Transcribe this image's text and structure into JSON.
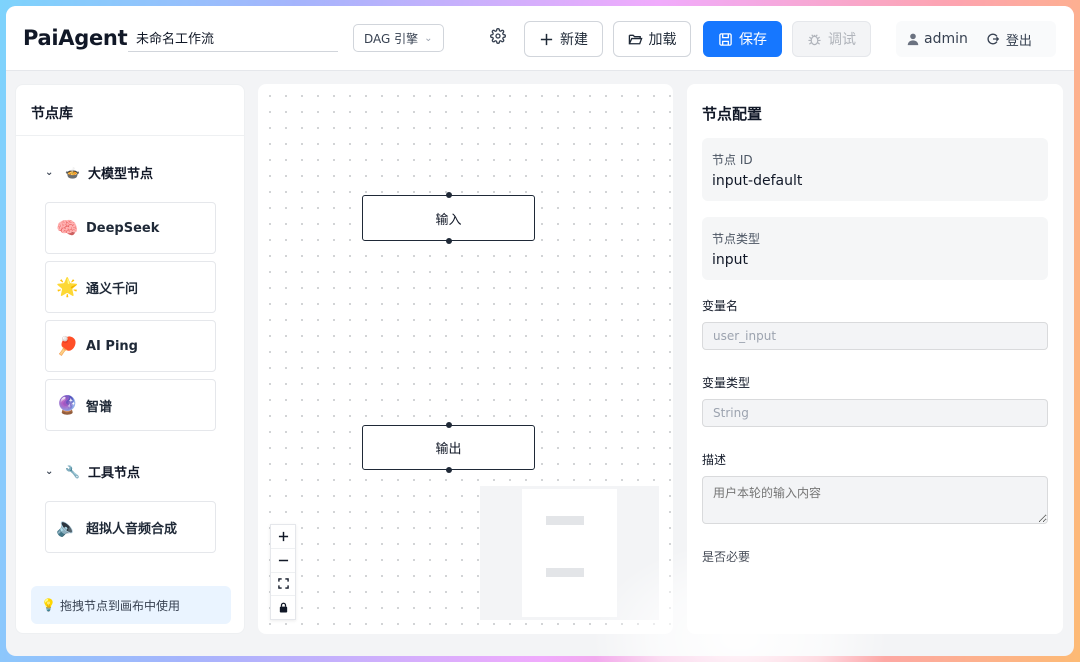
{
  "header": {
    "logo": "PaiAgent",
    "workflow_name": "未命名工作流",
    "engine_label": "DAG 引擎",
    "new_label": "新建",
    "load_label": "加载",
    "save_label": "保存",
    "debug_label": "调试",
    "user_name": "admin",
    "logout_label": "登出"
  },
  "sidebar": {
    "title": "节点库",
    "categories": [
      {
        "label": "大模型节点",
        "icon": "llm-pot-icon",
        "nodes": [
          {
            "label": "DeepSeek",
            "icon": "brain-icon"
          },
          {
            "label": "通义千问",
            "icon": "star-icon"
          },
          {
            "label": "AI Ping",
            "icon": "ping-pong-icon"
          },
          {
            "label": "智谱",
            "icon": "crystal-ball-icon"
          }
        ]
      },
      {
        "label": "工具节点",
        "icon": "wrench-icon",
        "nodes": [
          {
            "label": "超拟人音频合成",
            "icon": "speaker-icon"
          }
        ]
      }
    ],
    "tip": "拖拽节点到画布中使用"
  },
  "canvas": {
    "nodes": [
      {
        "label": "输入"
      },
      {
        "label": "输出"
      }
    ]
  },
  "panel": {
    "title": "节点配置",
    "node_id_label": "节点 ID",
    "node_id_value": "input-default",
    "node_type_label": "节点类型",
    "node_type_value": "input",
    "var_name_label": "变量名",
    "var_name_value": "user_input",
    "var_type_label": "变量类型",
    "var_type_value": "String",
    "desc_label": "描述",
    "desc_placeholder": "用户本轮的输入内容",
    "required_label": "是否必要"
  },
  "colors": {
    "primary": "#1677ff",
    "node_border": "#1f2937",
    "tip_bg": "#eaf4ff"
  }
}
